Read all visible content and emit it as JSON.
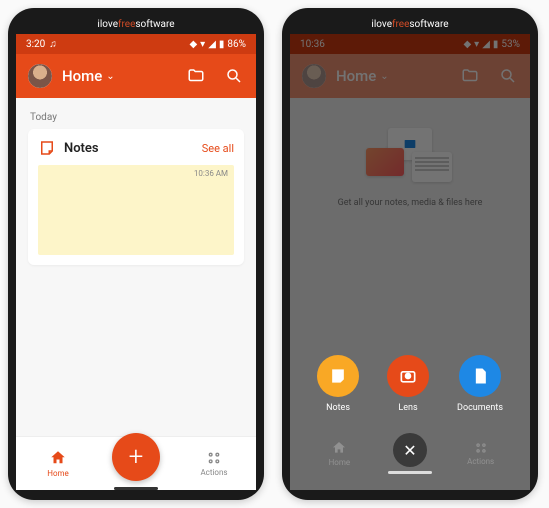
{
  "watermark": {
    "pre": "ilove",
    "mid": "free",
    "post": "software"
  },
  "phone1": {
    "statusbar": {
      "time": "3:20",
      "battery": "86%"
    },
    "appbar": {
      "title": "Home"
    },
    "content": {
      "day_label": "Today",
      "card": {
        "title": "Notes",
        "see_all": "See all",
        "note_time": "10:36 AM"
      }
    },
    "bottombar": {
      "home": "Home",
      "actions": "Actions",
      "fab": "+"
    }
  },
  "phone2": {
    "statusbar": {
      "time": "10:36",
      "battery": "53%"
    },
    "appbar": {
      "title": "Home"
    },
    "empty_text": "Get all your notes, media & files here",
    "actions": {
      "notes": "Notes",
      "lens": "Lens",
      "documents": "Documents",
      "close": "✕"
    },
    "bottombar": {
      "home": "Home",
      "actions": "Actions"
    }
  }
}
